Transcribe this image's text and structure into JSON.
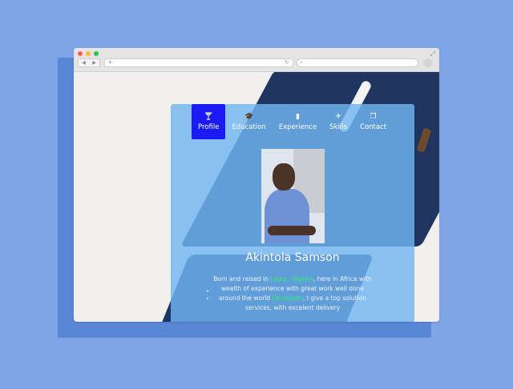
{
  "browser": {
    "dot_colors": [
      "#ff5f57",
      "#febc2e",
      "#28c840"
    ],
    "back_glyph": "◀",
    "forward_glyph": "▶",
    "new_tab_glyph": "+",
    "reload_glyph": "↻",
    "search_glyph": "⌕",
    "expand_glyph": "⤢"
  },
  "nav": {
    "items": [
      {
        "label": "Profile",
        "icon": "cocktail-icon",
        "glyph": "🍸",
        "active": true
      },
      {
        "label": "Education",
        "icon": "graduation-cap-icon",
        "glyph": "🎓"
      },
      {
        "label": "Experience",
        "icon": "id-card-icon",
        "glyph": "▮"
      },
      {
        "label": "Skills",
        "icon": "plane-icon",
        "glyph": "✈"
      },
      {
        "label": "Contact",
        "icon": "copy-icon",
        "glyph": "❐"
      }
    ]
  },
  "profile": {
    "name": "Akintola Samson",
    "bio_part1": "Born and raised in ",
    "bio_highlight1": "Lagos, Nigeria",
    "bio_part2": ", here in Africa with wealth of experience with great work well done around the world ",
    "bio_highlight2": "Developer",
    "bio_part3": ", I give a top solution services, with excelent delivery"
  },
  "colors": {
    "background": "#7fa5e6",
    "panel": "#70b4f2",
    "active_nav": "#1a1af2",
    "highlight": "#2ef06a"
  }
}
